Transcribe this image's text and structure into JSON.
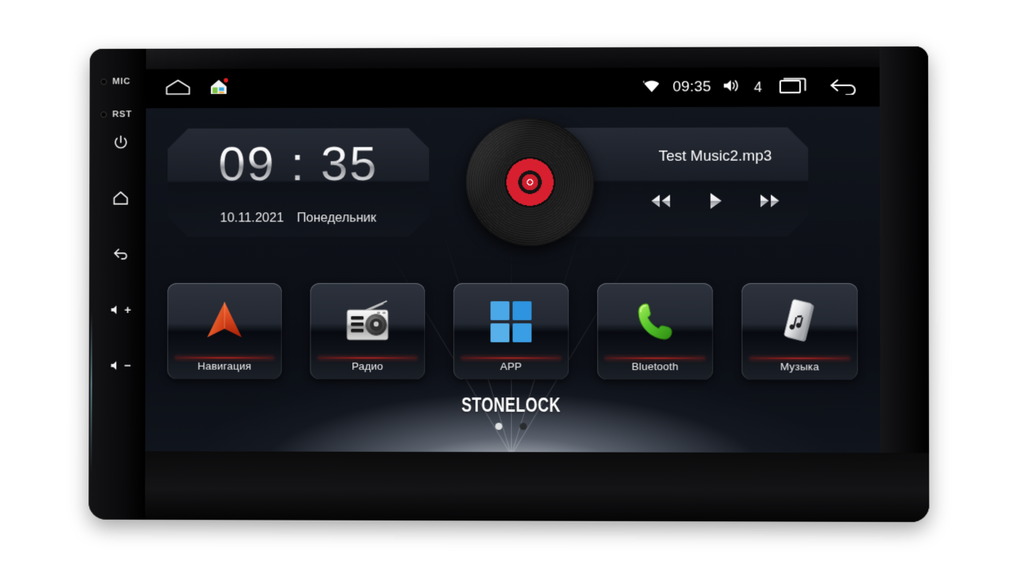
{
  "device": {
    "side_buttons": [
      {
        "name": "mic",
        "label": "MIC",
        "type": "hole"
      },
      {
        "name": "reset",
        "label": "RST",
        "type": "hole"
      },
      {
        "name": "power",
        "label": "",
        "type": "icon"
      },
      {
        "name": "home",
        "label": "",
        "type": "icon"
      },
      {
        "name": "back",
        "label": "",
        "type": "icon"
      },
      {
        "name": "volume-up",
        "label": "+",
        "type": "icon"
      },
      {
        "name": "volume-down",
        "label": "−",
        "type": "icon"
      }
    ]
  },
  "statusbar": {
    "left_icons": [
      "home-outline-icon",
      "house-color-icon"
    ],
    "wifi_icon": "wifi-icon",
    "time": "09:35",
    "volume_icon": "volume-icon",
    "volume_level": "4",
    "recents_icon": "recent-apps-icon",
    "back_icon": "back-arrow-icon"
  },
  "clock_widget": {
    "hours": "09",
    "separator": ":",
    "minutes": "35",
    "date": "10.11.2021",
    "weekday": "Понедельник"
  },
  "music_widget": {
    "album_art": "vinyl-record-icon",
    "track_title": "Test Music2.mp3",
    "controls": [
      {
        "name": "previous-track-button",
        "icon": "rewind-icon"
      },
      {
        "name": "play-button",
        "icon": "play-icon"
      },
      {
        "name": "next-track-button",
        "icon": "fast-forward-icon"
      }
    ]
  },
  "dock": {
    "tiles": [
      {
        "id": "navigation",
        "label": "Навигация",
        "icon": "navigation-arrow-icon"
      },
      {
        "id": "radio",
        "label": "Радио",
        "icon": "radio-icon"
      },
      {
        "id": "app",
        "label": "APP",
        "icon": "app-grid-icon"
      },
      {
        "id": "bluetooth",
        "label": "Bluetooth",
        "icon": "phone-handset-icon"
      },
      {
        "id": "music",
        "label": "Музыка",
        "icon": "usb-music-icon"
      }
    ]
  },
  "footer": {
    "brand": "STONELOCK",
    "page_dots": [
      {
        "state": "active"
      },
      {
        "state": "idle"
      }
    ]
  },
  "colors": {
    "accent_red": "#d81f2f",
    "tile_divider": "#ff3c32",
    "screen_bg": "#10141c",
    "nav_orange": "#e8431c",
    "app_blue": "#3fa0e8",
    "bluetooth_green": "#5ec832"
  }
}
